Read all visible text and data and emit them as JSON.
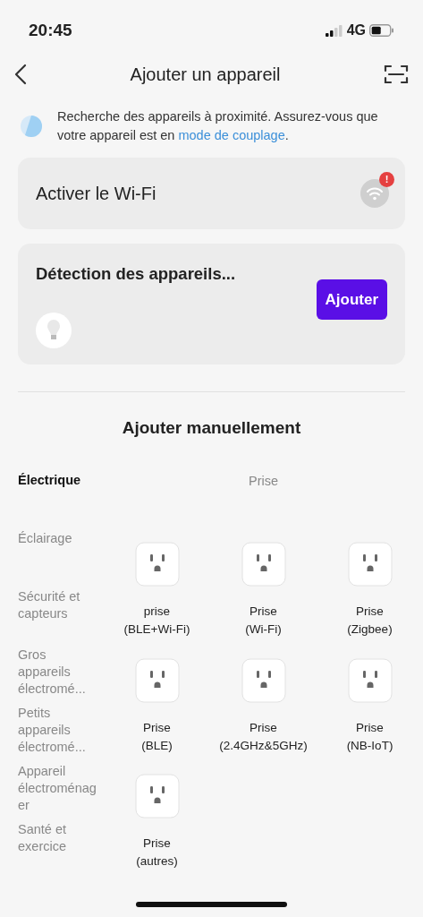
{
  "status_bar": {
    "time": "20:45",
    "network": "4G"
  },
  "header": {
    "title": "Ajouter un appareil"
  },
  "notice": {
    "text": "Recherche des appareils à proximité. Assurez-vous que votre appareil est en ",
    "link": "mode de couplage",
    "after": "."
  },
  "wifi_card": {
    "label": "Activer le Wi-Fi",
    "alert": "!"
  },
  "detection_card": {
    "title": "Détection des appareils...",
    "button": "Ajouter"
  },
  "manual": {
    "title": "Ajouter manuellement",
    "categories": [
      {
        "label": "Électrique",
        "selected": true
      },
      {
        "label": "Éclairage",
        "selected": false
      },
      {
        "label": "Sécurité et capteurs",
        "selected": false
      },
      {
        "label": "Gros appareils électromé...",
        "selected": false
      },
      {
        "label": "Petits appareils électromé...",
        "selected": false
      },
      {
        "label": "Appareil électroménager",
        "selected": false
      },
      {
        "label": "Santé et exercice",
        "selected": false
      }
    ],
    "section": "Prise",
    "devices": [
      {
        "name": "prise",
        "variant": "(BLE+Wi-Fi)"
      },
      {
        "name": "Prise",
        "variant": "(Wi-Fi)"
      },
      {
        "name": "Prise",
        "variant": "(Zigbee)"
      },
      {
        "name": "Prise",
        "variant": "(BLE)"
      },
      {
        "name": "Prise",
        "variant": "(2.4GHz&5GHz)"
      },
      {
        "name": "Prise",
        "variant": "(NB-IoT)"
      },
      {
        "name": "Prise",
        "variant": "(autres)"
      }
    ]
  }
}
